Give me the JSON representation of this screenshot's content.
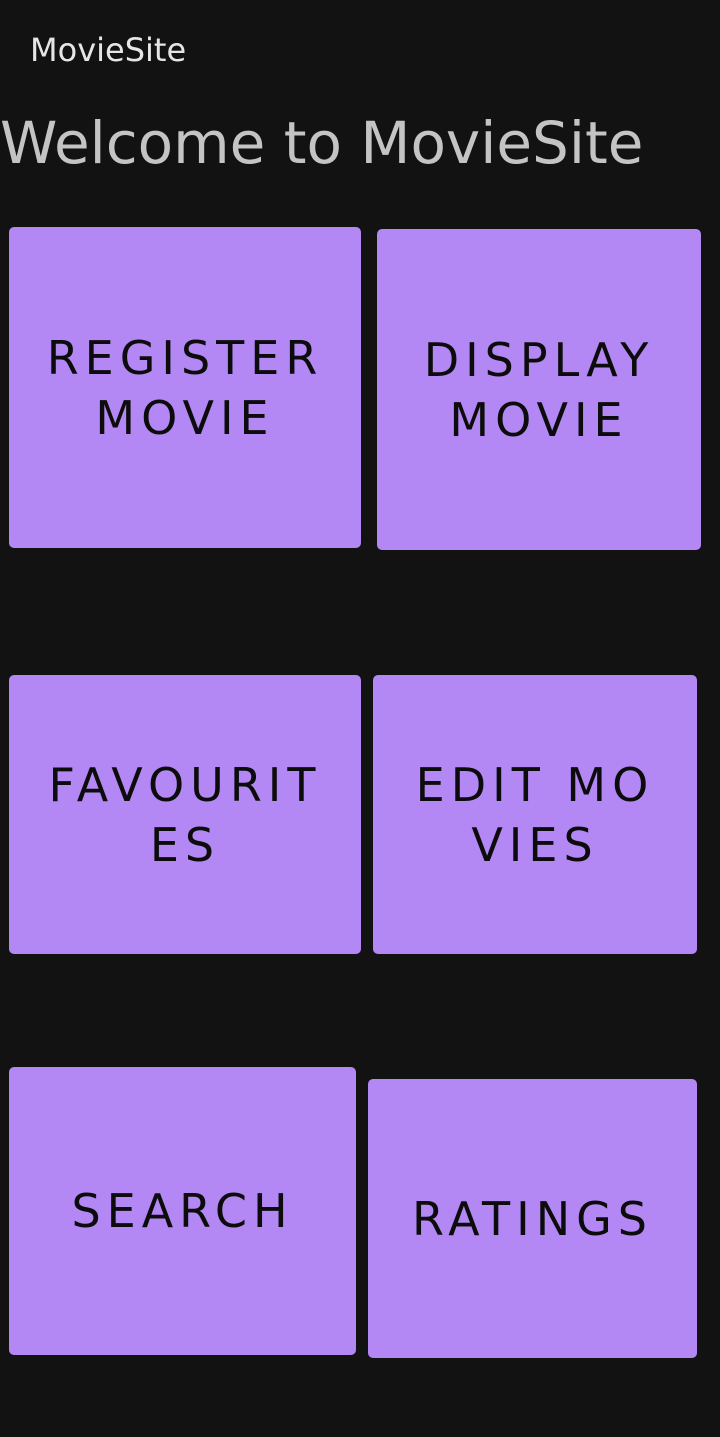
{
  "app_bar": {
    "title": "MovieSite"
  },
  "welcome": {
    "text": "Welcome to MovieSite"
  },
  "tiles": {
    "register": "REGISTER MOVIE",
    "display": "DISPLAY MOVIE",
    "favourites": "FAVOURITES",
    "edit": "EDIT MOVIES",
    "search": "SEARCH",
    "ratings": "RATINGS"
  },
  "colors": {
    "background": "#121212",
    "tile": "#b388f4",
    "tile_text": "#0c0c0c",
    "title_text": "#e6e6e6",
    "welcome_text": "#c4c4c4"
  }
}
